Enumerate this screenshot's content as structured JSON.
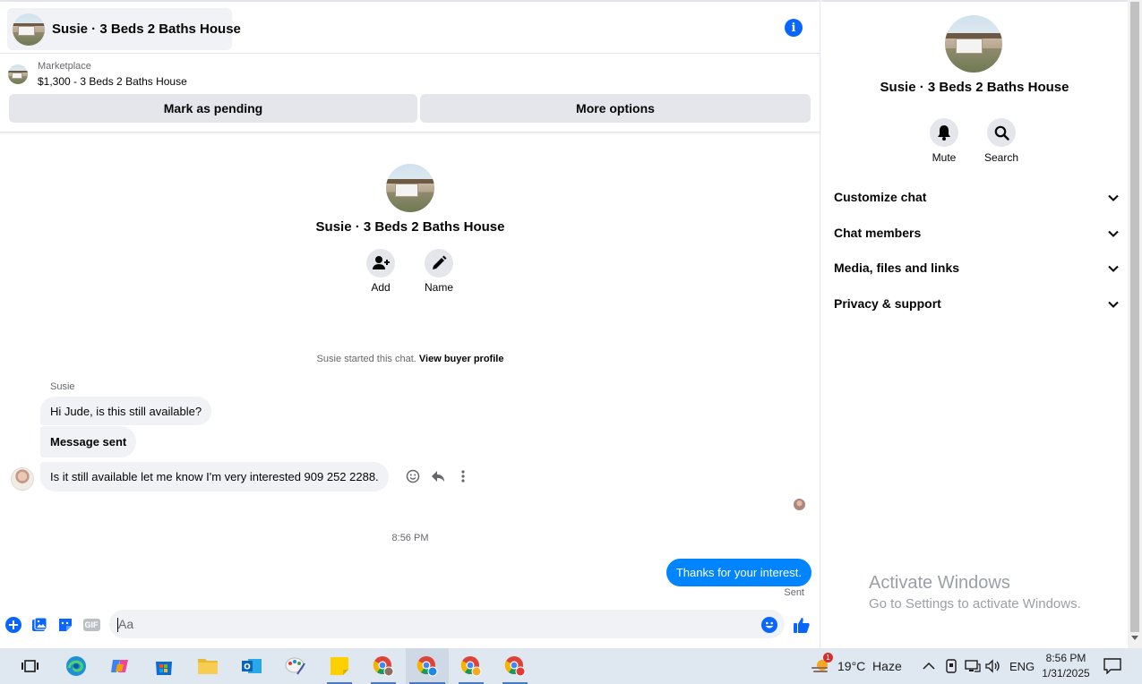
{
  "conversation": {
    "title": "Susie · 3 Beds 2 Baths House"
  },
  "listing": {
    "kind": "Marketplace",
    "title": "$1,300 - 3 Beds 2 Baths House",
    "pending_button": "Mark as pending",
    "more_button": "More options"
  },
  "intro": {
    "title": "Susie · 3 Beds 2 Baths House",
    "add_label": "Add",
    "name_label": "Name",
    "started_text": "Susie started this chat.",
    "buyer_profile_link": "View buyer profile"
  },
  "messages": {
    "sender": "Susie",
    "incoming": [
      "Hi Jude, is this still available?",
      "Message sent",
      "Is it still available let me know I'm very interested 909 252 2288."
    ],
    "timestamp": "8:56 PM",
    "outgoing": "Thanks for your interest.",
    "status": "Sent"
  },
  "composer": {
    "placeholder": "Aa",
    "gif_label": "GIF"
  },
  "panel": {
    "title": "Susie · 3 Beds 2 Baths House",
    "mute_label": "Mute",
    "search_label": "Search",
    "sections": [
      "Customize chat",
      "Chat members",
      "Media, files and links",
      "Privacy & support"
    ]
  },
  "watermark": {
    "title": "Activate Windows",
    "subtitle": "Go to Settings to activate Windows."
  },
  "taskbar": {
    "weather": "19°C  Haze",
    "weather_badge": "1",
    "language": "ENG",
    "time": "8:56 PM",
    "date": "1/31/2025"
  },
  "colors": {
    "accent": "#0866ff",
    "outgoing_bubble": "#0084ff",
    "bubble_gray": "#f0f2f5",
    "button_gray": "#e4e6eb"
  }
}
